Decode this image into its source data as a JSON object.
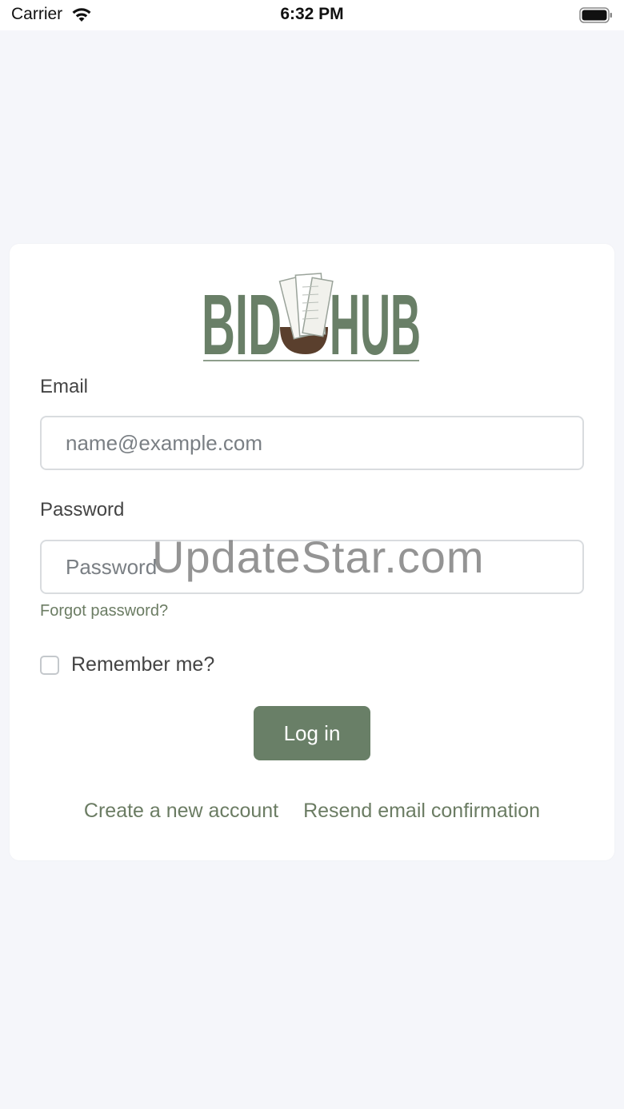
{
  "status_bar": {
    "carrier": "Carrier",
    "time": "6:32 PM"
  },
  "logo": {
    "text_left": "BID",
    "text_right": "HUB",
    "brand_color": "#697f67"
  },
  "form": {
    "email_label": "Email",
    "email_placeholder": "name@example.com",
    "password_label": "Password",
    "password_placeholder": "Password",
    "forgot_password": "Forgot password?",
    "remember_me": "Remember me?",
    "remember_checked": false,
    "login_button": "Log in"
  },
  "links": {
    "create_account": "Create a new account",
    "resend_confirmation": "Resend email confirmation"
  },
  "watermark": "UpdateStar.com",
  "colors": {
    "accent": "#697f67",
    "link": "#6b7c63",
    "background": "#f5f6fa"
  }
}
